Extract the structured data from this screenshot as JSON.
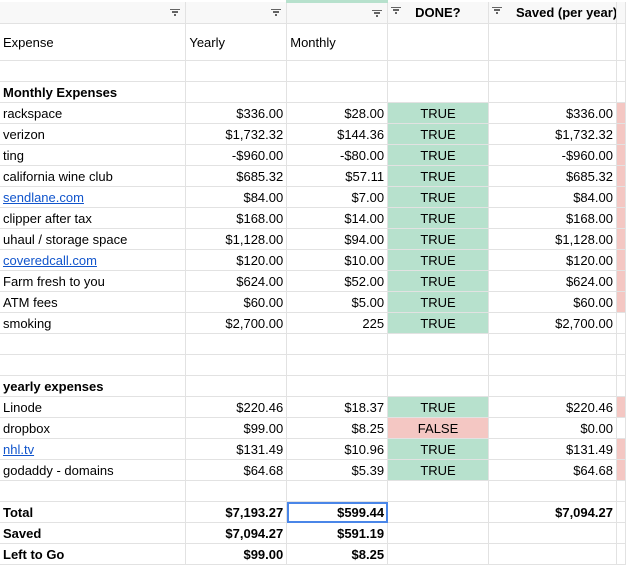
{
  "header": {
    "col_a": "",
    "col_b": "",
    "col_c": "",
    "col_d": "DONE?",
    "col_e": "Saved (per year)",
    "col_f": ""
  },
  "columns": {
    "expense": "Expense",
    "yearly": "Yearly",
    "monthly": "Monthly"
  },
  "sections": {
    "monthly": "Monthly Expenses",
    "yearly": "yearly expenses"
  },
  "monthly_rows": [
    {
      "name": "rackspace",
      "yearly": "$336.00",
      "monthly": "$28.00",
      "done": "TRUE",
      "saved": "$336.00",
      "link": false
    },
    {
      "name": "verizon",
      "yearly": "$1,732.32",
      "monthly": "$144.36",
      "done": "TRUE",
      "saved": "$1,732.32",
      "link": false
    },
    {
      "name": "ting",
      "yearly": "-$960.00",
      "monthly": "-$80.00",
      "done": "TRUE",
      "saved": "-$960.00",
      "link": false
    },
    {
      "name": "california wine club",
      "yearly": "$685.32",
      "monthly": "$57.11",
      "done": "TRUE",
      "saved": "$685.32",
      "link": false
    },
    {
      "name": "sendlane.com",
      "yearly": "$84.00",
      "monthly": "$7.00",
      "done": "TRUE",
      "saved": "$84.00",
      "link": true
    },
    {
      "name": "clipper after tax",
      "yearly": "$168.00",
      "monthly": "$14.00",
      "done": "TRUE",
      "saved": "$168.00",
      "link": false
    },
    {
      "name": "uhaul / storage space",
      "yearly": "$1,128.00",
      "monthly": "$94.00",
      "done": "TRUE",
      "saved": "$1,128.00",
      "link": false
    },
    {
      "name": "coveredcall.com",
      "yearly": "$120.00",
      "monthly": "$10.00",
      "done": "TRUE",
      "saved": "$120.00",
      "link": true
    },
    {
      "name": "Farm fresh to you",
      "yearly": "$624.00",
      "monthly": "$52.00",
      "done": "TRUE",
      "saved": "$624.00",
      "link": false
    },
    {
      "name": "ATM fees",
      "yearly": "$60.00",
      "monthly": "$5.00",
      "done": "TRUE",
      "saved": "$60.00",
      "link": false
    },
    {
      "name": "smoking",
      "yearly": "$2,700.00",
      "monthly": "225",
      "done": "TRUE",
      "saved": "$2,700.00",
      "link": false
    }
  ],
  "yearly_rows": [
    {
      "name": "Linode",
      "yearly": "$220.46",
      "monthly": "$18.37",
      "done": "TRUE",
      "saved": "$220.46",
      "link": false
    },
    {
      "name": "dropbox",
      "yearly": "$99.00",
      "monthly": "$8.25",
      "done": "FALSE",
      "saved": "$0.00",
      "link": false
    },
    {
      "name": "nhl.tv",
      "yearly": "$131.49",
      "monthly": "$10.96",
      "done": "TRUE",
      "saved": "$131.49",
      "link": true
    },
    {
      "name": "godaddy - domains",
      "yearly": "$64.68",
      "monthly": "$5.39",
      "done": "TRUE",
      "saved": "$64.68",
      "link": false
    }
  ],
  "totals": {
    "total_label": "Total",
    "total_yearly": "$7,193.27",
    "total_monthly": "$599.44",
    "total_saved": "$7,094.27",
    "saved_label": "Saved",
    "saved_yearly": "$7,094.27",
    "saved_monthly": "$591.19",
    "left_label": "Left to Go",
    "left_yearly": "$99.00",
    "left_monthly": "$8.25"
  },
  "colors": {
    "true_bg": "#b7e1cd",
    "false_bg": "#f4c7c3",
    "selection": "#4a86e8",
    "link": "#1155cc"
  },
  "icons": {
    "filter": "filter-icon"
  }
}
